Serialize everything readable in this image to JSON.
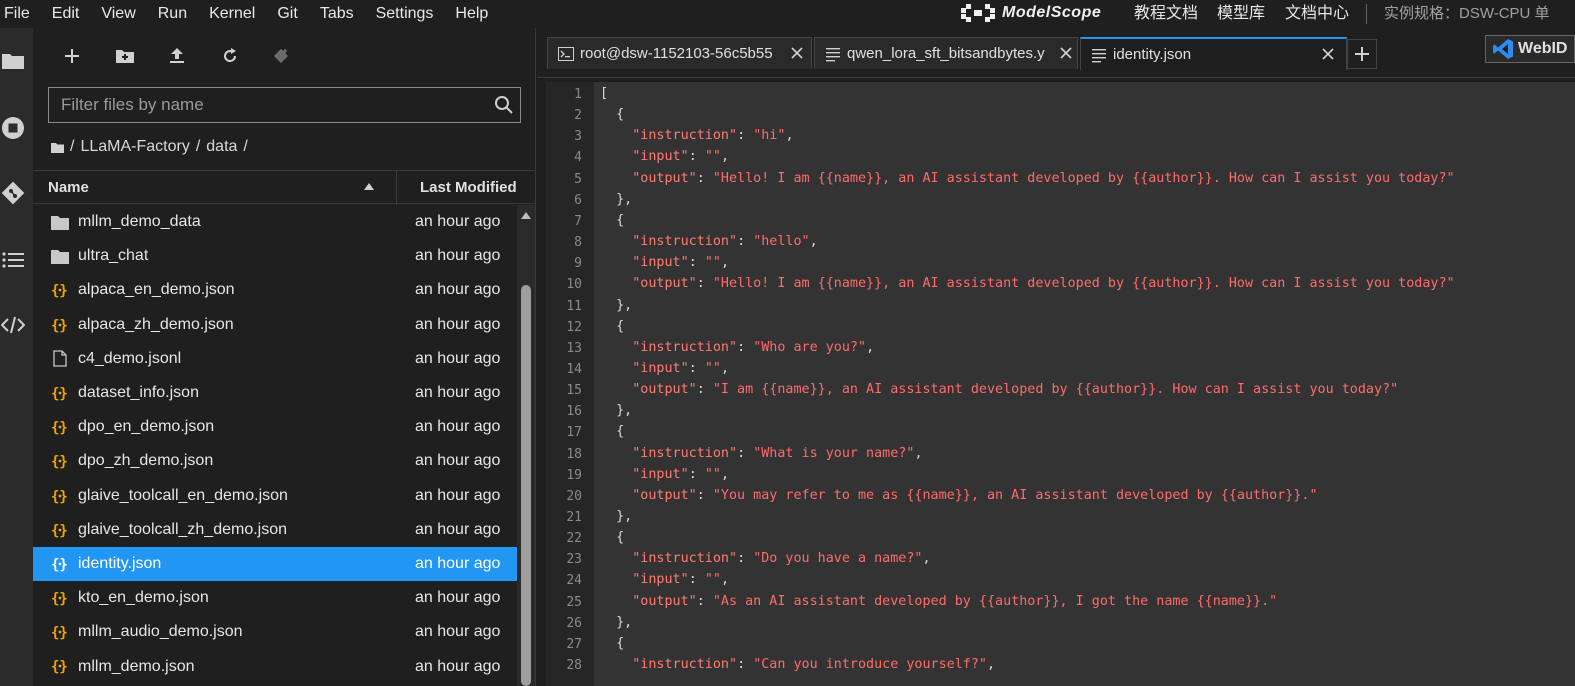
{
  "menubar": {
    "items": [
      "File",
      "Edit",
      "View",
      "Run",
      "Kernel",
      "Git",
      "Tabs",
      "Settings",
      "Help"
    ],
    "brand": "ModelScope",
    "links": [
      "教程文档",
      "模型库",
      "文档中心"
    ],
    "spec": "实例规格：DSW-CPU 单"
  },
  "filebrowser": {
    "filter_placeholder": "Filter files by name",
    "breadcrumb": [
      "LLaMA-Factory",
      "data"
    ],
    "header_name": "Name",
    "header_modified": "Last Modified",
    "files": [
      {
        "name": "mllm_demo_data",
        "type": "folder",
        "modified": "an hour ago"
      },
      {
        "name": "ultra_chat",
        "type": "folder",
        "modified": "an hour ago"
      },
      {
        "name": "alpaca_en_demo.json",
        "type": "json",
        "modified": "an hour ago"
      },
      {
        "name": "alpaca_zh_demo.json",
        "type": "json",
        "modified": "an hour ago"
      },
      {
        "name": "c4_demo.jsonl",
        "type": "file",
        "modified": "an hour ago"
      },
      {
        "name": "dataset_info.json",
        "type": "json",
        "modified": "an hour ago"
      },
      {
        "name": "dpo_en_demo.json",
        "type": "json",
        "modified": "an hour ago"
      },
      {
        "name": "dpo_zh_demo.json",
        "type": "json",
        "modified": "an hour ago"
      },
      {
        "name": "glaive_toolcall_en_demo.json",
        "type": "json",
        "modified": "an hour ago"
      },
      {
        "name": "glaive_toolcall_zh_demo.json",
        "type": "json",
        "modified": "an hour ago"
      },
      {
        "name": "identity.json",
        "type": "json",
        "modified": "an hour ago",
        "selected": true
      },
      {
        "name": "kto_en_demo.json",
        "type": "json",
        "modified": "an hour ago"
      },
      {
        "name": "mllm_audio_demo.json",
        "type": "json",
        "modified": "an hour ago"
      },
      {
        "name": "mllm_demo.json",
        "type": "json",
        "modified": "an hour ago"
      }
    ]
  },
  "tabs": [
    {
      "label": "root@dsw-1152103-56c5b55",
      "icon": "terminal-icon"
    },
    {
      "label": "qwen_lora_sft_bitsandbytes.y",
      "icon": "text-file-icon"
    },
    {
      "label": "identity.json",
      "icon": "text-file-icon",
      "active": true
    }
  ],
  "webide_label": "WebID",
  "editor": {
    "lines": [
      [
        [
          "p",
          "["
        ]
      ],
      [
        [
          "p",
          "  {"
        ]
      ],
      [
        [
          "p",
          "    "
        ],
        [
          "k",
          "\"instruction\""
        ],
        [
          "p",
          ": "
        ],
        [
          "s",
          "\"hi\""
        ],
        [
          "p",
          ","
        ]
      ],
      [
        [
          "p",
          "    "
        ],
        [
          "k",
          "\"input\""
        ],
        [
          "p",
          ": "
        ],
        [
          "s",
          "\"\""
        ],
        [
          "p",
          ","
        ]
      ],
      [
        [
          "p",
          "    "
        ],
        [
          "k",
          "\"output\""
        ],
        [
          "p",
          ": "
        ],
        [
          "s",
          "\"Hello! I am {{name}}, an AI assistant developed by {{author}}. How can I assist you today?\""
        ]
      ],
      [
        [
          "p",
          "  },"
        ]
      ],
      [
        [
          "p",
          "  {"
        ]
      ],
      [
        [
          "p",
          "    "
        ],
        [
          "k",
          "\"instruction\""
        ],
        [
          "p",
          ": "
        ],
        [
          "s",
          "\"hello\""
        ],
        [
          "p",
          ","
        ]
      ],
      [
        [
          "p",
          "    "
        ],
        [
          "k",
          "\"input\""
        ],
        [
          "p",
          ": "
        ],
        [
          "s",
          "\"\""
        ],
        [
          "p",
          ","
        ]
      ],
      [
        [
          "p",
          "    "
        ],
        [
          "k",
          "\"output\""
        ],
        [
          "p",
          ": "
        ],
        [
          "s",
          "\"Hello! I am {{name}}, an AI assistant developed by {{author}}. How can I assist you today?\""
        ]
      ],
      [
        [
          "p",
          "  },"
        ]
      ],
      [
        [
          "p",
          "  {"
        ]
      ],
      [
        [
          "p",
          "    "
        ],
        [
          "k",
          "\"instruction\""
        ],
        [
          "p",
          ": "
        ],
        [
          "s",
          "\"Who are you?\""
        ],
        [
          "p",
          ","
        ]
      ],
      [
        [
          "p",
          "    "
        ],
        [
          "k",
          "\"input\""
        ],
        [
          "p",
          ": "
        ],
        [
          "s",
          "\"\""
        ],
        [
          "p",
          ","
        ]
      ],
      [
        [
          "p",
          "    "
        ],
        [
          "k",
          "\"output\""
        ],
        [
          "p",
          ": "
        ],
        [
          "s",
          "\"I am {{name}}, an AI assistant developed by {{author}}. How can I assist you today?\""
        ]
      ],
      [
        [
          "p",
          "  },"
        ]
      ],
      [
        [
          "p",
          "  {"
        ]
      ],
      [
        [
          "p",
          "    "
        ],
        [
          "k",
          "\"instruction\""
        ],
        [
          "p",
          ": "
        ],
        [
          "s",
          "\"What is your name?\""
        ],
        [
          "p",
          ","
        ]
      ],
      [
        [
          "p",
          "    "
        ],
        [
          "k",
          "\"input\""
        ],
        [
          "p",
          ": "
        ],
        [
          "s",
          "\"\""
        ],
        [
          "p",
          ","
        ]
      ],
      [
        [
          "p",
          "    "
        ],
        [
          "k",
          "\"output\""
        ],
        [
          "p",
          ": "
        ],
        [
          "s",
          "\"You may refer to me as {{name}}, an AI assistant developed by {{author}}.\""
        ]
      ],
      [
        [
          "p",
          "  },"
        ]
      ],
      [
        [
          "p",
          "  {"
        ]
      ],
      [
        [
          "p",
          "    "
        ],
        [
          "k",
          "\"instruction\""
        ],
        [
          "p",
          ": "
        ],
        [
          "s",
          "\"Do you have a name?\""
        ],
        [
          "p",
          ","
        ]
      ],
      [
        [
          "p",
          "    "
        ],
        [
          "k",
          "\"input\""
        ],
        [
          "p",
          ": "
        ],
        [
          "s",
          "\"\""
        ],
        [
          "p",
          ","
        ]
      ],
      [
        [
          "p",
          "    "
        ],
        [
          "k",
          "\"output\""
        ],
        [
          "p",
          ": "
        ],
        [
          "s",
          "\"As an AI assistant developed by {{author}}, I got the name {{name}}.\""
        ]
      ],
      [
        [
          "p",
          "  },"
        ]
      ],
      [
        [
          "p",
          "  {"
        ]
      ],
      [
        [
          "p",
          "    "
        ],
        [
          "k",
          "\"instruction\""
        ],
        [
          "p",
          ": "
        ],
        [
          "s",
          "\"Can you introduce yourself?\""
        ],
        [
          "p",
          ","
        ]
      ]
    ]
  }
}
